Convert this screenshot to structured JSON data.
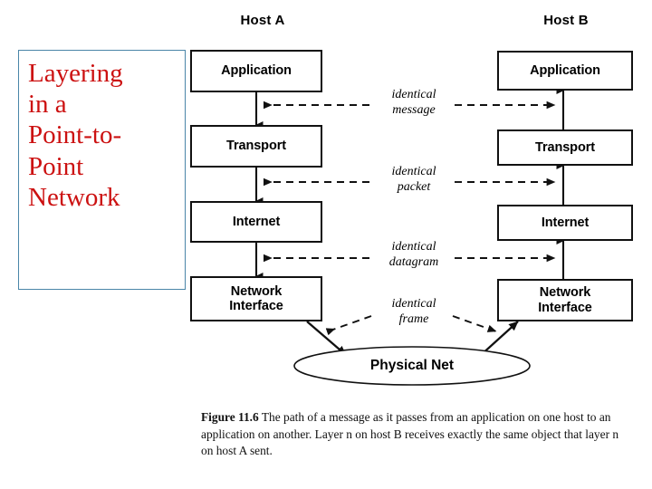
{
  "slide": {
    "background_color": "#ffffff"
  },
  "title_box": {
    "text": "Layering in a Point-to-Point Network",
    "lines": "Layering\nin a\nPoint-to-\nPoint\nNetwork",
    "text_color": "#cc1111",
    "border_color": "#4a86a8"
  },
  "figure": {
    "hosts": [
      {
        "id": "host-a",
        "label": "Host A"
      },
      {
        "id": "host-b",
        "label": "Host B"
      }
    ],
    "host_a_layers": [
      {
        "label": "Application"
      },
      {
        "label": "Transport"
      },
      {
        "label": "Internet"
      },
      {
        "label": "Network\nInterface"
      }
    ],
    "host_b_layers": [
      {
        "label": "Application"
      },
      {
        "label": "Transport"
      },
      {
        "label": "Internet"
      },
      {
        "label": "Network\nInterface"
      }
    ],
    "middle_labels": [
      {
        "label": "identical\nmessage"
      },
      {
        "label": "identical\npacket"
      },
      {
        "label": "identical\ndatagram"
      },
      {
        "label": "identical\nframe"
      }
    ],
    "physical_net": {
      "label": "Physical Net"
    },
    "stroke_color": "#111111"
  },
  "caption": {
    "number": "Figure 11.6",
    "body": "The path of a message as it passes from an application on one host to an application on another.  Layer n on host B receives exactly the same object that layer n on host A sent.",
    "full": "Figure 11.6 The path of a message as it passes from an application on one host to an application on another.  Layer n on host B receives exactly the same object that layer n on host A sent."
  }
}
